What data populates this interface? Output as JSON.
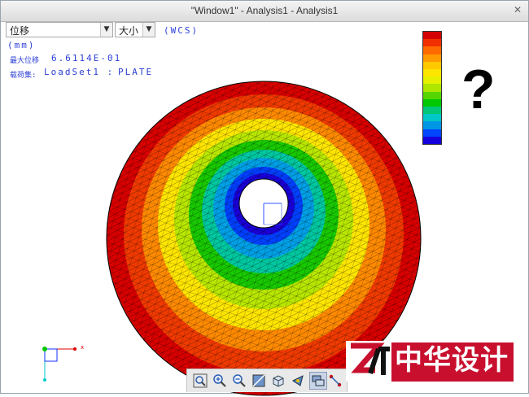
{
  "window": {
    "title": "\"Window1\" - Analysis1 - Analysis1",
    "close_glyph": "✕"
  },
  "controls": {
    "quantity": "位移",
    "component": "大小",
    "coord_system": "(WCS)"
  },
  "result_info": {
    "unit": "(mm)",
    "max_label": "最大位移",
    "max_value": "6.6114E-01",
    "loadset_label": "载荷集:",
    "loadset_value": "LoadSet1 :",
    "model": "PLATE"
  },
  "legend": {
    "question_mark": "?",
    "colors": [
      "#d40000",
      "#f03000",
      "#ff6a00",
      "#ff9b00",
      "#ffc800",
      "#ffe600",
      "#e6f000",
      "#aee600",
      "#55d600",
      "#00c800",
      "#00c878",
      "#00c8c8",
      "#0096e6",
      "#0046ff",
      "#1400dc"
    ]
  },
  "triad": {
    "x_label": "x"
  },
  "toolbar": {
    "icons": [
      "zoom-fit-icon",
      "zoom-in-icon",
      "zoom-out-icon",
      "shading-icon",
      "orient-icon",
      "view-rotate-icon",
      "display-icon",
      "mesh-display-icon"
    ]
  },
  "watermark": {
    "text": "中华设计"
  }
}
